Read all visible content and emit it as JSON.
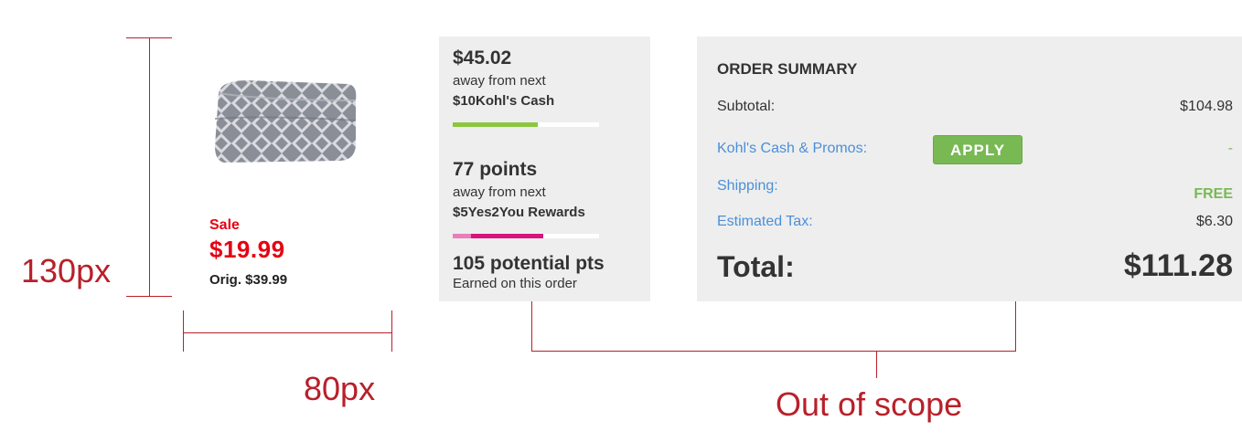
{
  "colors": {
    "annotation": "#b8202a",
    "sale_red": "#e60012",
    "link_blue": "#4a90d9",
    "green": "#79b954",
    "kohls_cash_bar": "#8cc63f",
    "rewards_bar_light": "#e87fb9",
    "rewards_bar_dark": "#d6147c",
    "panel_bg": "#eeeeee"
  },
  "annotations": {
    "height_label": "130px",
    "width_label": "80px",
    "scope_label": "Out of scope"
  },
  "product": {
    "sale_label": "Sale",
    "sale_price": "$19.99",
    "orig_price": "Orig. $39.99"
  },
  "rewards": {
    "cash_amount": "$45.02",
    "cash_away": "away from next",
    "cash_reward": "$10Kohl's Cash",
    "cash_progress": 0.58,
    "points": "77 points",
    "points_away": "away from next",
    "points_reward": "$5Yes2You Rewards",
    "points_progress": 0.62,
    "potential": "105 potential pts",
    "potential_note": "Earned on this order"
  },
  "summary": {
    "title": "ORDER SUMMARY",
    "subtotal_label": "Subtotal:",
    "subtotal_value": "$104.98",
    "promos_label": "Kohl's Cash & Promos:",
    "apply_label": "APPLY",
    "promos_value": "-",
    "shipping_label": "Shipping:",
    "shipping_value": "FREE",
    "tax_label": "Estimated Tax:",
    "tax_value": "$6.30",
    "total_label": "Total:",
    "total_value": "$111.28"
  }
}
